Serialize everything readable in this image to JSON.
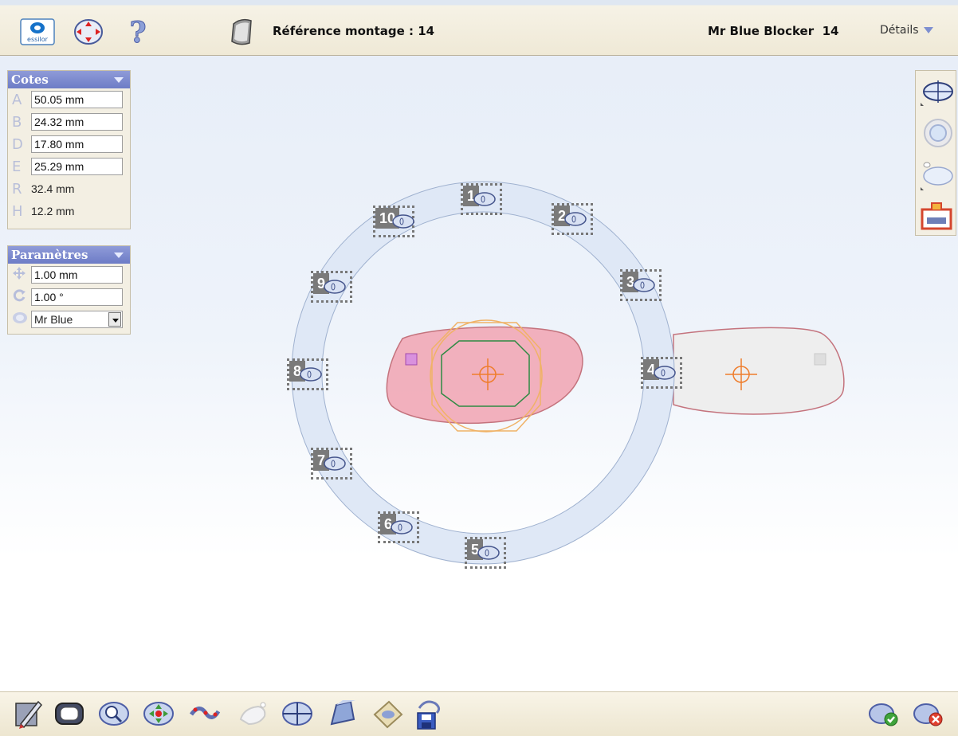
{
  "header": {
    "reference_label": "Référence montage : 14",
    "job_name": "Mr Blue Blocker",
    "job_number": "14",
    "details_label": "Détails",
    "logo_text": "essilor"
  },
  "cotes": {
    "title": "Cotes",
    "rows": [
      {
        "letter": "A",
        "value": "50.05 mm",
        "editable": true
      },
      {
        "letter": "B",
        "value": "24.32 mm",
        "editable": true
      },
      {
        "letter": "D",
        "value": "17.80 mm",
        "editable": true
      },
      {
        "letter": "E",
        "value": "25.29 mm",
        "editable": true
      },
      {
        "letter": "R",
        "value": "32.4 mm",
        "editable": false
      },
      {
        "letter": "H",
        "value": "12.2 mm",
        "editable": false
      }
    ]
  },
  "parametres": {
    "title": "Paramètres",
    "step_move": "1.00 mm",
    "step_rotate": "1.00 °",
    "blocker_selected": "Mr Blue"
  },
  "blocker_slots": [
    "1",
    "2",
    "3",
    "4",
    "5",
    "6",
    "7",
    "8",
    "9",
    "10"
  ],
  "icons": {
    "top": [
      "essilor-logo-icon",
      "centering-target-icon",
      "help-icon",
      "lens-tilt-icon"
    ],
    "right": [
      "lens-axis-view-icon",
      "lens-front-view-icon",
      "lens-side-view-icon",
      "blocker-mount-icon"
    ],
    "bottom": [
      "edit-pencil-icon",
      "frame-shape-icon",
      "zoom-lens-icon",
      "move-lens-icon",
      "curve-edit-icon",
      "drill-hole-icon",
      "centering-cross-icon",
      "lens-3d-icon",
      "scan-card-icon",
      "save-disk-icon"
    ],
    "actions": [
      "validate-icon",
      "cancel-icon"
    ]
  },
  "colors": {
    "panel_header": "#7b88cd",
    "lens_pink": "#ee9aa8",
    "ring_blue": "#dfe8f6",
    "center_cross": "#ef7d2c"
  }
}
